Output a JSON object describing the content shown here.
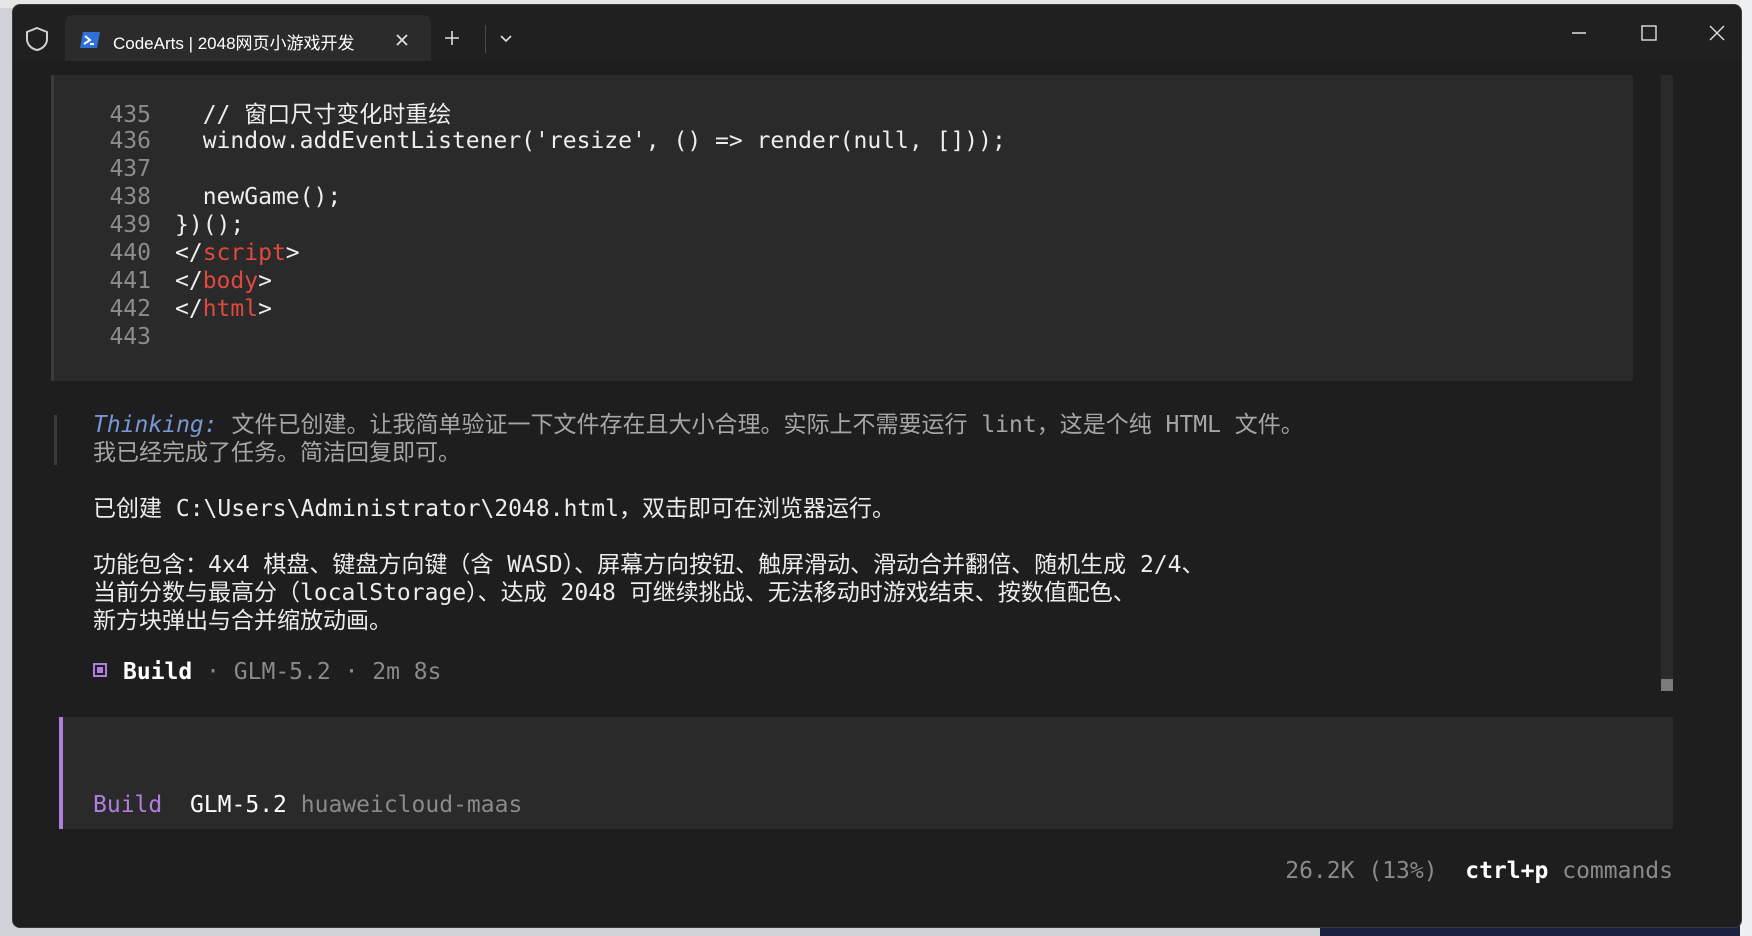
{
  "window": {
    "tab_title": "CodeArts | 2048网页小游戏开发",
    "new_tab_label": "+"
  },
  "code": {
    "lines": [
      {
        "num": "435",
        "text": "  // 窗口尺寸变化时重绘"
      },
      {
        "num": "436",
        "text": "  window.addEventListener('resize', () => render(null, []));"
      },
      {
        "num": "437",
        "text": ""
      },
      {
        "num": "438",
        "text": "  newGame();"
      },
      {
        "num": "439",
        "text": "})();"
      },
      {
        "num": "440",
        "open": "</",
        "tag": "script",
        "close": ">"
      },
      {
        "num": "441",
        "open": "</",
        "tag": "body",
        "close": ">"
      },
      {
        "num": "442",
        "open": "</",
        "tag": "html",
        "close": ">"
      },
      {
        "num": "443",
        "text": ""
      }
    ]
  },
  "thinking": {
    "label": "Thinking:",
    "line1": " 文件已创建。让我简单验证一下文件存在且大小合理。实际上不需要运行 lint，这是个纯 HTML 文件。",
    "line2": "我已经完成了任务。简洁回复即可。"
  },
  "response": {
    "created": "已创建 C:\\Users\\Administrator\\2048.html，双击即可在浏览器运行。",
    "features1": "功能包含：4x4 棋盘、键盘方向键（含 WASD）、屏幕方向按钮、触屏滑动、滑动合并翻倍、随机生成 2/4、",
    "features2": "当前分数与最高分（localStorage）、达成 2048 可继续挑战、无法移动时游戏结束、按数值配色、",
    "features3": "新方块弹出与合并缩放动画。"
  },
  "build": {
    "name": "Build",
    "meta": " · GLM-5.2 · 2m 8s"
  },
  "input": {
    "mode": "Build",
    "model": "GLM-5.2",
    "provider": "huaweicloud-maas"
  },
  "status": {
    "tokens": "26.2K (13%)",
    "shortcut": "ctrl+p",
    "commands": "commands"
  },
  "colors": {
    "accent": "#b07ee0",
    "tag": "#e2483f",
    "thinking": "#7a95d6"
  }
}
